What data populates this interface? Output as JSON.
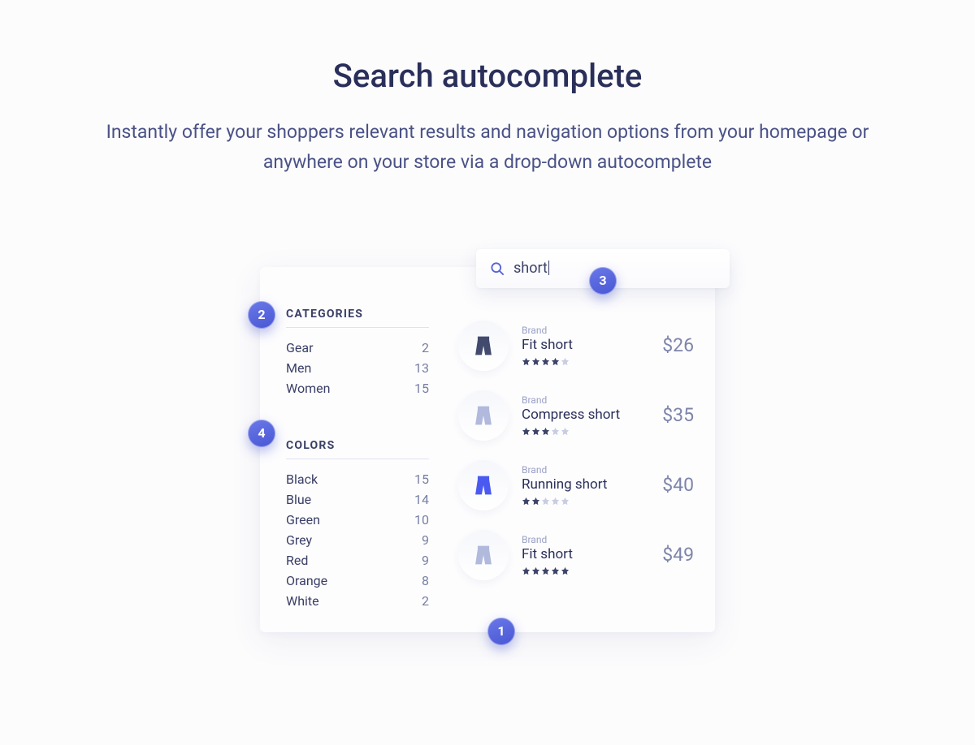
{
  "header": {
    "title": "Search autocomplete",
    "subtitle": "Instantly offer your shoppers relevant results and navigation options from your homepage or anywhere on your store via a drop-down autocomplete"
  },
  "search": {
    "query": "short"
  },
  "facets": {
    "categories": {
      "label": "CATEGORIES",
      "items": [
        {
          "label": "Gear",
          "count": "2"
        },
        {
          "label": "Men",
          "count": "13"
        },
        {
          "label": "Women",
          "count": "15"
        }
      ]
    },
    "colors": {
      "label": "COLORS",
      "items": [
        {
          "label": "Black",
          "count": "15"
        },
        {
          "label": "Blue",
          "count": "14"
        },
        {
          "label": "Green",
          "count": "10"
        },
        {
          "label": "Grey",
          "count": "9"
        },
        {
          "label": "Red",
          "count": "9"
        },
        {
          "label": "Orange",
          "count": "8"
        },
        {
          "label": "White",
          "count": "2"
        }
      ]
    }
  },
  "products": [
    {
      "brand": "Brand",
      "name": "Fit short",
      "price": "$26",
      "stars": 4,
      "thumb_color": "#424a6e"
    },
    {
      "brand": "Brand",
      "name": "Compress short",
      "price": "$35",
      "stars": 3,
      "thumb_color": "#b1b9dd"
    },
    {
      "brand": "Brand",
      "name": "Running short",
      "price": "$40",
      "stars": 2,
      "thumb_color": "#4a5af0"
    },
    {
      "brand": "Brand",
      "name": "Fit short",
      "price": "$49",
      "stars": 5,
      "thumb_color": "#b1b9dd"
    }
  ],
  "callouts": {
    "c1": "1",
    "c2": "2",
    "c3": "3",
    "c4": "4"
  }
}
